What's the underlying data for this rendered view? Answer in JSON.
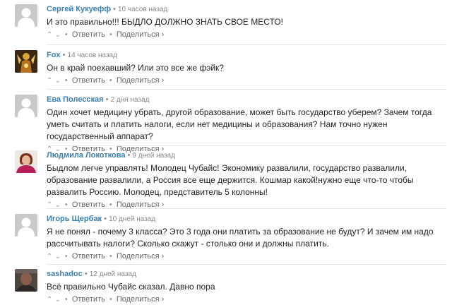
{
  "comments": [
    {
      "author": "Сергей Кукуефф",
      "time": "10 часов назад",
      "text": "И это правильно!!! БЫДЛО ДОЛЖНО ЗНАТЬ СВОЕ МЕСТО!",
      "reply": "Ответить",
      "share": "Поделиться ›",
      "avatar": "default"
    },
    {
      "author": "Fox",
      "time": "14 часов назад",
      "text": "Он в край поехавший? Или это все же фэйк?",
      "reply": "Ответить",
      "share": "Поделиться ›",
      "avatar": "fox"
    },
    {
      "author": "Ева Полесская",
      "time": "2 дня назад",
      "text": "Один хочет медицину убрать, другой образование, может быть государство уберем? Зачем тогда уметь считать и платить налоги, если нет медицины и образования? Нам точно нужен государственный аппарат?",
      "reply": "Ответить",
      "share": "Поделиться ›",
      "avatar": "default"
    },
    {
      "author": "Людмила Локоткова",
      "time": "9 дней назад",
      "text": "Быдлом легче управлять! Молодец Чубайс! Экономику развалили, государство развалили, образование развалили, а Россия все еще держится. Кошмар какой!нужно еще что-то чтобы развалить Россию. Молодец, представитель 5 колонны!",
      "reply": "Ответить",
      "share": "Поделиться ›",
      "avatar": "woman"
    },
    {
      "author": "Игорь Щербак",
      "time": "10 дней назад",
      "text": "Я не понял - почему 3 класса? Это 3 года они платить за образование не будут? И зачем им надо рассчитывать налоги? Сколько скажут - столько они и должны платить.",
      "reply": "Ответить",
      "share": "Поделиться ›",
      "avatar": "default"
    },
    {
      "author": "sashadoc",
      "time": "12 дней назад",
      "text": "Всё правильно Чубайс сказал. Давно пора",
      "reply": "Ответить",
      "share": "Поделиться ›",
      "avatar": "dark"
    }
  ],
  "separator": "•",
  "icons": [
    "avatar-default-icon",
    "vote-up-icon",
    "vote-down-icon"
  ]
}
